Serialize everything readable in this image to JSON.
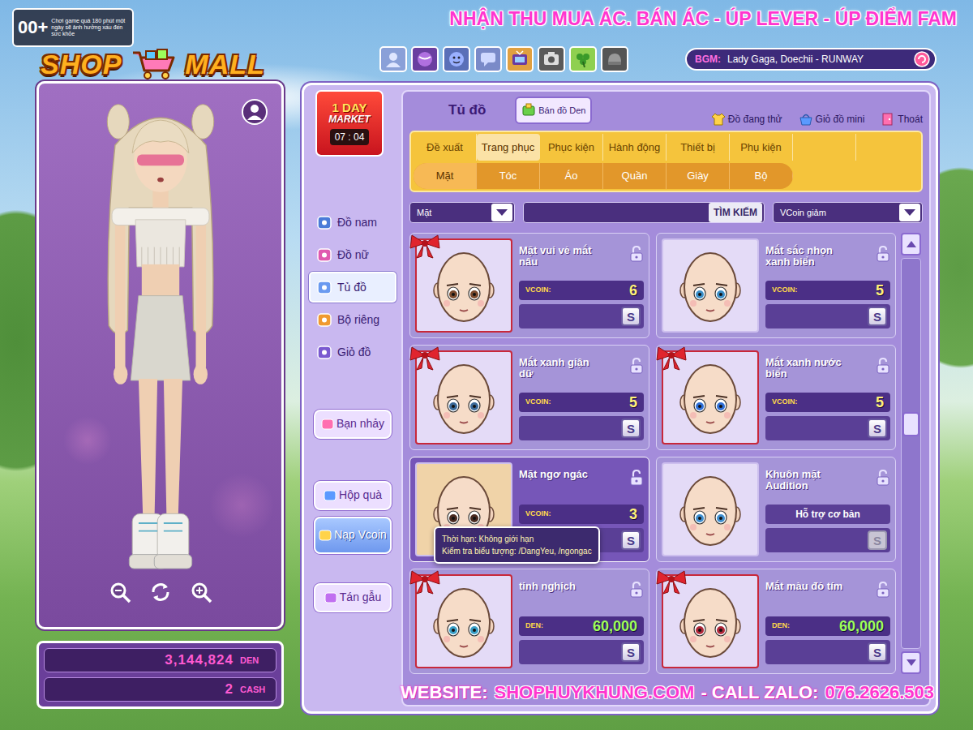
{
  "age_rating": {
    "label": "00+",
    "warning": "Chơi game quá 180 phút một ngày sẽ ảnh hưởng xấu đến sức khỏe"
  },
  "logo": {
    "left": "SHOP",
    "right": "MALL"
  },
  "banner": "NHẬN THU MUA ÁC. BÁN ÁC - ÚP LEVER - ÚP ĐIỂM FAM",
  "bgm": {
    "label": "BGM:",
    "song": "Lady Gaga, Doechii - RUNWAY"
  },
  "market": {
    "top": "1 DAY",
    "bottom": "MARKET",
    "timer": "07 : 04"
  },
  "window": {
    "title": "Tủ đồ",
    "sell_button": "Bán đồ Den",
    "links": [
      "Đồ đang thử",
      "Giỏ đồ mini",
      "Thoát"
    ]
  },
  "sidebar": {
    "items": [
      {
        "label": "Đồ nam",
        "selected": false
      },
      {
        "label": "Đồ nữ",
        "selected": false
      },
      {
        "label": "Tủ đồ",
        "selected": true
      },
      {
        "label": "Bộ riêng",
        "selected": false
      },
      {
        "label": "Giỏ đồ",
        "selected": false
      }
    ],
    "buttons": [
      "Bạn nhảy",
      "Hộp quà",
      "Nạp Vcoin",
      "Tán gẫu"
    ]
  },
  "tabs": [
    {
      "label": "Đề xuất",
      "selected": false
    },
    {
      "label": "Trang phục",
      "selected": true
    },
    {
      "label": "Phục kiện",
      "selected": false
    },
    {
      "label": "Hành động",
      "selected": false
    },
    {
      "label": "Thiết bị",
      "selected": false
    },
    {
      "label": "Phụ kiện",
      "selected": false
    }
  ],
  "subtabs": [
    {
      "label": "Mặt",
      "selected": true
    },
    {
      "label": "Tóc",
      "selected": false
    },
    {
      "label": "Áo",
      "selected": false
    },
    {
      "label": "Quần",
      "selected": false
    },
    {
      "label": "Giày",
      "selected": false
    },
    {
      "label": "Bộ",
      "selected": false
    }
  ],
  "filter": {
    "category": "Mặt",
    "search_button": "TÌM KIẾM",
    "sort": "VCoin giảm"
  },
  "items": [
    {
      "title": "Mặt vui vẻ mắt nâu",
      "kind": "vcoin",
      "currency": "VCOIN:",
      "price": "6",
      "gift": true,
      "selected": false,
      "button": "S",
      "disabled": false,
      "color": "#7b4a2c"
    },
    {
      "title": "Mắt sắc nhọn xanh biển",
      "kind": "vcoin",
      "currency": "VCOIN:",
      "price": "5",
      "gift": false,
      "selected": false,
      "button": "S",
      "disabled": false,
      "color": "#3a8fc8"
    },
    {
      "title": "Mắt xanh giận dữ",
      "kind": "vcoin",
      "currency": "VCOIN:",
      "price": "5",
      "gift": true,
      "selected": false,
      "button": "S",
      "disabled": false,
      "color": "#3a6a9a"
    },
    {
      "title": "Mắt xanh nước biển",
      "kind": "vcoin",
      "currency": "VCOIN:",
      "price": "5",
      "gift": true,
      "selected": false,
      "button": "S",
      "disabled": false,
      "color": "#2f6fd8"
    },
    {
      "title": "Mặt ngơ ngác",
      "kind": "vcoin",
      "currency": "VCOIN:",
      "price": "3",
      "gift": false,
      "selected": true,
      "button": "S",
      "disabled": false,
      "color": "#4a2a20"
    },
    {
      "title": "Khuôn mặt Audition",
      "kind": "basic",
      "note": "Hỗ trợ cơ bản",
      "gift": false,
      "selected": false,
      "button": "S",
      "disabled": true,
      "color": "#3f8fd0"
    },
    {
      "title": "tinh nghịch",
      "kind": "den",
      "currency": "DEN:",
      "price": "60,000",
      "gift": true,
      "selected": false,
      "button": "S",
      "disabled": false,
      "color": "#3aa0c8"
    },
    {
      "title": "Mắt màu đỏ tím",
      "kind": "den",
      "currency": "DEN:",
      "price": "60,000",
      "gift": true,
      "selected": false,
      "button": "S",
      "disabled": false,
      "color": "#b0283a"
    }
  ],
  "tooltip": [
    "Thời hạn: Không giới hạn",
    "Kiểm tra biểu tượng: /DangYeu, /ngongac"
  ],
  "scroll": {
    "position": 0.42
  },
  "wallet": [
    {
      "amount": "3,144,824",
      "unit": "DEN"
    },
    {
      "amount": "2",
      "unit": "CASH"
    }
  ],
  "footer": {
    "label": "WEBSITE:",
    "site": "SHOPHUYKHUNG.COM",
    "call": "- CALL ZALO:",
    "phone": "076.2626.503"
  }
}
